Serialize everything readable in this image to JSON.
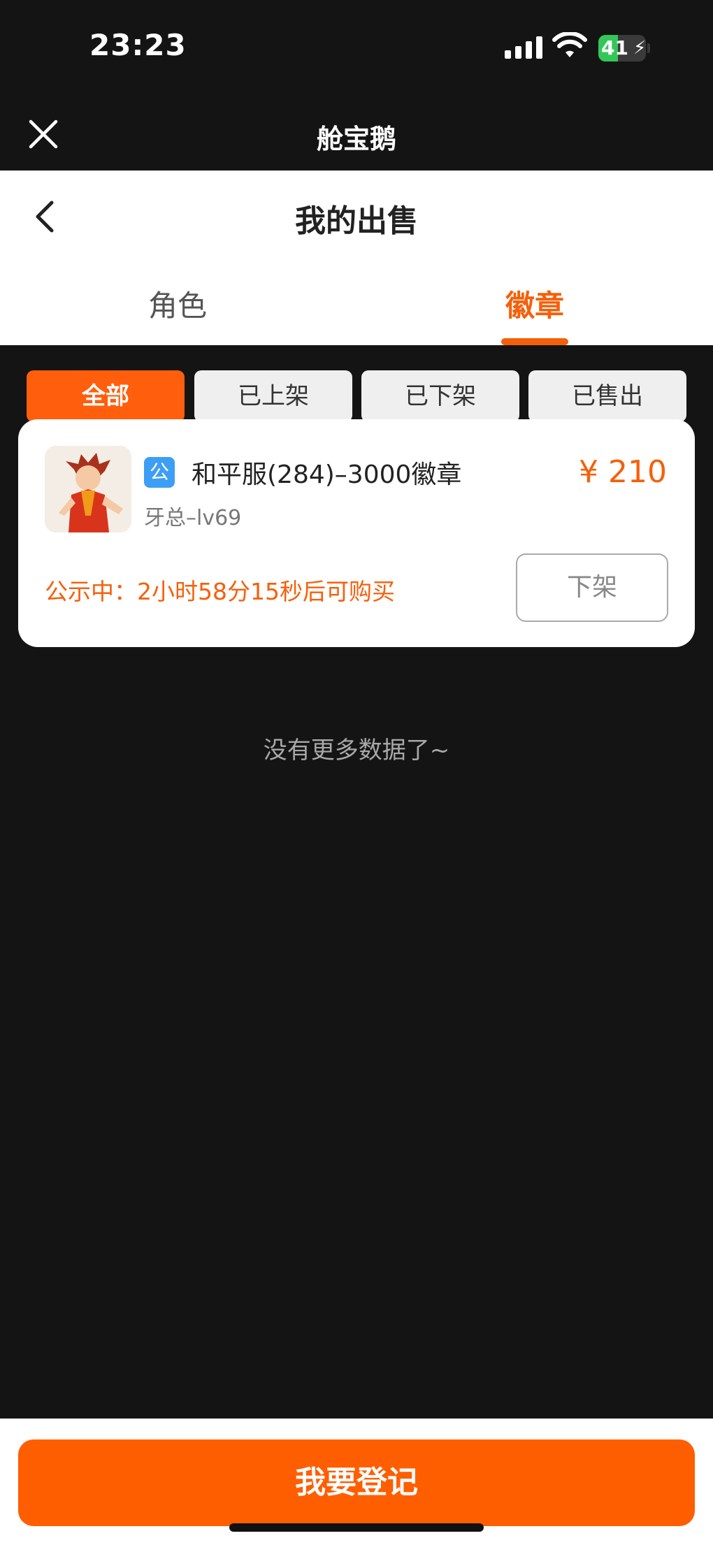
{
  "status_bar": {
    "time": "23:23",
    "battery": "41",
    "battery_level": 0.41,
    "icons": [
      "signal-icon",
      "wifi-icon",
      "battery-icon"
    ]
  },
  "miniapp": {
    "title": "舱宝鹅",
    "close_icon": "close-icon"
  },
  "header": {
    "back_icon": "chevron-left-icon",
    "title": "我的出售",
    "tabs": [
      {
        "label": "角色",
        "active": false
      },
      {
        "label": "徽章",
        "active": true
      }
    ]
  },
  "filters": [
    {
      "label": "全部",
      "active": true
    },
    {
      "label": "已上架",
      "active": false
    },
    {
      "label": "已下架",
      "active": false
    },
    {
      "label": "已售出",
      "active": false
    }
  ],
  "listing": {
    "tag": "公",
    "title": "和平服(284)–3000徽章",
    "seller": "牙总–lv69",
    "price": "¥ 210",
    "countdown": "公示中：2小时58分15秒后可购买",
    "delist_label": "下架"
  },
  "no_more_text": "没有更多数据了~",
  "register_label": "我要登记",
  "colors": {
    "accent": "#f5600a",
    "button": "#ff5e00",
    "tag_blue": "#3d9ef5",
    "background": "#141414"
  }
}
